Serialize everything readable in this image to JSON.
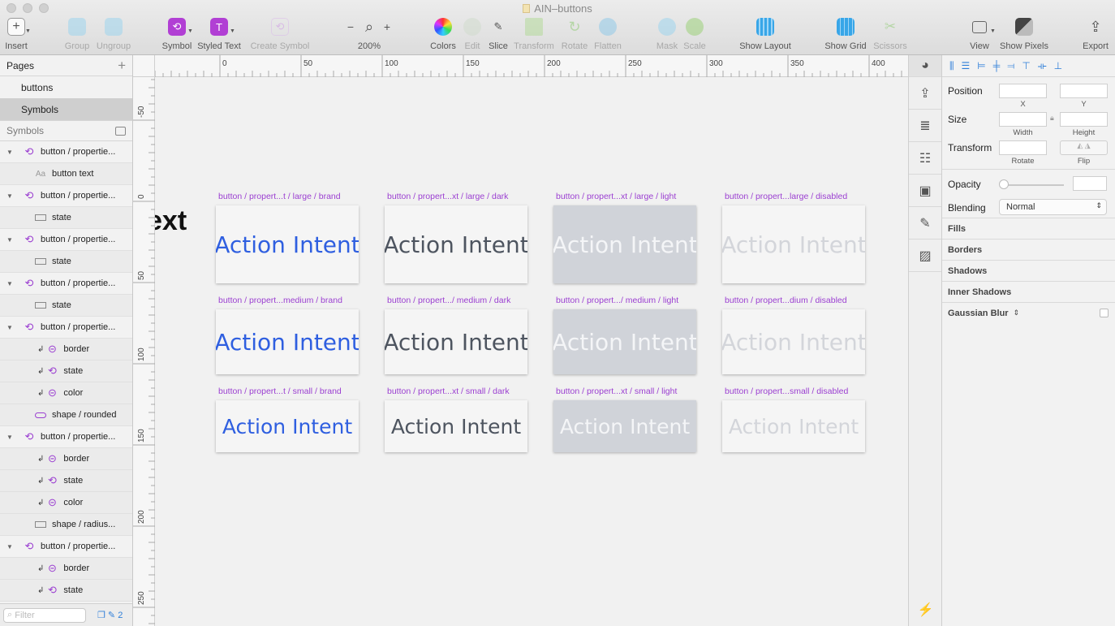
{
  "window": {
    "title": "AIN–buttons"
  },
  "toolbar": {
    "insert": "Insert",
    "group": "Group",
    "ungroup": "Ungroup",
    "symbol": "Symbol",
    "styled_text": "Styled Text",
    "create_symbol": "Create Symbol",
    "zoom_minus": "−",
    "zoom_plus": "+",
    "zoom_level": "200%",
    "colors": "Colors",
    "edit": "Edit",
    "slice": "Slice",
    "transform": "Transform",
    "rotate": "Rotate",
    "flatten": "Flatten",
    "mask": "Mask",
    "scale": "Scale",
    "show_layout": "Show Layout",
    "show_grid": "Show Grid",
    "scissors": "Scissors",
    "view": "View",
    "show_pixels": "Show Pixels",
    "export": "Export"
  },
  "sidebar": {
    "pages_header": "Pages",
    "pages": [
      "buttons",
      "Symbols"
    ],
    "symbols_header": "Symbols",
    "filter_placeholder": "Filter",
    "filter_count": "2",
    "layers": [
      {
        "label": "button / propertie...",
        "kind": "symbol-group"
      },
      {
        "label": "button text",
        "kind": "text"
      },
      {
        "label": "button / propertie...",
        "kind": "symbol-group"
      },
      {
        "label": "state",
        "kind": "rect"
      },
      {
        "label": "button / propertie...",
        "kind": "symbol-group"
      },
      {
        "label": "state",
        "kind": "rect"
      },
      {
        "label": "button / propertie...",
        "kind": "symbol-group"
      },
      {
        "label": "state",
        "kind": "rect-edit"
      },
      {
        "label": "button / propertie...",
        "kind": "symbol-group"
      },
      {
        "label": "border",
        "kind": "symbol-instance"
      },
      {
        "label": "state",
        "kind": "symbol-instance-alt"
      },
      {
        "label": "color",
        "kind": "symbol-instance"
      },
      {
        "label": "shape / rounded",
        "kind": "rounded"
      },
      {
        "label": "button / propertie...",
        "kind": "symbol-group"
      },
      {
        "label": "border",
        "kind": "symbol-instance"
      },
      {
        "label": "state",
        "kind": "symbol-instance-alt"
      },
      {
        "label": "color",
        "kind": "symbol-instance"
      },
      {
        "label": "shape / radius...",
        "kind": "rect"
      },
      {
        "label": "button / propertie...",
        "kind": "symbol-group"
      },
      {
        "label": "border",
        "kind": "symbol-instance"
      },
      {
        "label": "state",
        "kind": "symbol-instance-alt"
      }
    ]
  },
  "canvas": {
    "partial_text": "ext",
    "ruler_top_labels": [
      "0",
      "50",
      "100",
      "150",
      "200",
      "250",
      "300",
      "350",
      "400"
    ],
    "ruler_left_labels": [
      "-50",
      "0",
      "50",
      "100",
      "150",
      "200",
      "250"
    ],
    "button_text": "Action Intent",
    "variants": [
      "brand",
      "dark",
      "light",
      "disabled"
    ],
    "sizes": [
      "large",
      "medium",
      "small"
    ],
    "colors": {
      "brand": "#2f5fe0",
      "dark": "#4e5560",
      "light": "#f4f5f7",
      "disabled": "#d3d5da"
    },
    "labels": [
      [
        "button / propert...t / large / brand",
        "button / propert...xt / large / dark",
        "button / propert...xt / large / light",
        "button / propert...large / disabled"
      ],
      [
        "button / propert...medium / brand",
        "button / propert.../ medium / dark",
        "button / propert.../ medium / light",
        "button / propert...dium / disabled"
      ],
      [
        "button / propert...t / small / brand",
        "button / propert...xt / small / dark",
        "button / propert...xt / small / light",
        "button / propert...small / disabled"
      ]
    ]
  },
  "inspector": {
    "position": "Position",
    "x": "X",
    "y": "Y",
    "size": "Size",
    "width": "Width",
    "height": "Height",
    "transform": "Transform",
    "rotate": "Rotate",
    "flip": "Flip",
    "opacity": "Opacity",
    "blending": "Blending",
    "blending_value": "Normal",
    "sections": [
      "Fills",
      "Borders",
      "Shadows",
      "Inner Shadows",
      "Gaussian Blur"
    ]
  }
}
